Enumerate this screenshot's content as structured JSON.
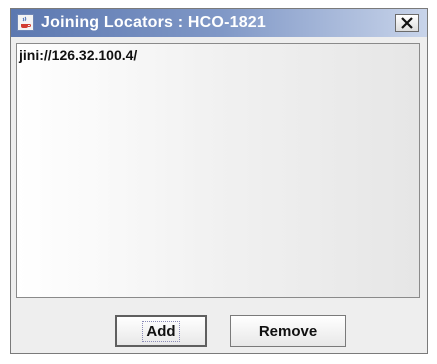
{
  "window": {
    "title": "Joining Locators : HCO-1821",
    "app_icon": "java-cup-icon",
    "close_icon": "close-icon"
  },
  "list": {
    "items": [
      {
        "label": "jini://126.32.100.4/"
      }
    ]
  },
  "buttons": {
    "add_label": "Add",
    "remove_label": "Remove"
  },
  "colors": {
    "titlebar_start": "#5c78b0",
    "titlebar_end": "#c8d4ea",
    "window_bg": "#eeeeee"
  }
}
